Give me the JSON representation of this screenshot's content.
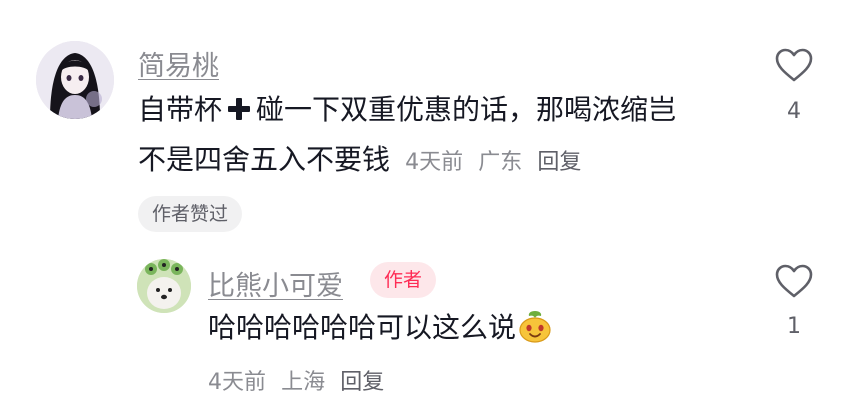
{
  "comment": {
    "username": "简易桃",
    "text_part1": "自带杯",
    "plus_icon": "heavy-plus-icon",
    "text_part2": "碰一下双重优惠的话，那喝浓缩岂",
    "text_line2": "不是四舍五入不要钱",
    "time": "4天前",
    "location": "广东",
    "reply_label": "回复",
    "like_count": "4",
    "author_liked_label": "作者赞过"
  },
  "reply": {
    "username": "比熊小可爱",
    "author_badge": "作者",
    "text": "哈哈哈哈哈哈可以这么说",
    "emoji_icon": "smiling-mango-emoji-icon",
    "time": "4天前",
    "location": "上海",
    "reply_label": "回复",
    "like_count": "1"
  },
  "colors": {
    "primary_text": "#161823",
    "secondary_text": "#8a8b91",
    "author_badge_text": "#fe2c55",
    "author_badge_bg": "#fde7ea",
    "pill_bg": "#f1f1f2"
  }
}
